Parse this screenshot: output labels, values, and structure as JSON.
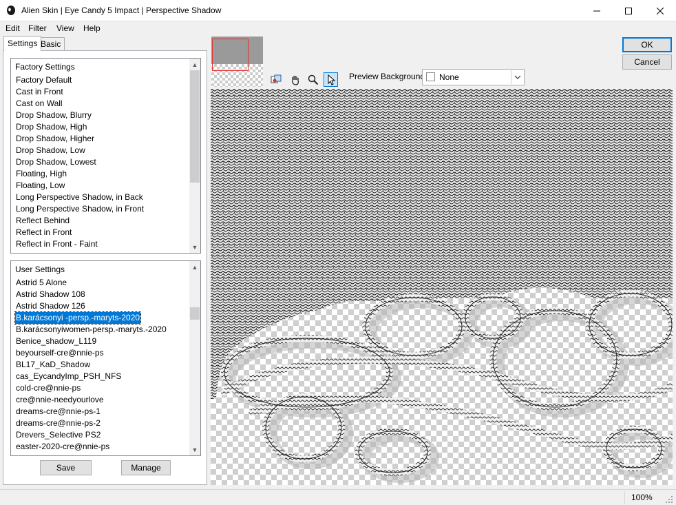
{
  "window": {
    "title": "Alien Skin | Eye Candy 5 Impact | Perspective Shadow"
  },
  "menu": {
    "edit": "Edit",
    "filter": "Filter",
    "view": "View",
    "help": "Help"
  },
  "tabs": {
    "settings": "Settings",
    "basic": "Basic"
  },
  "factory_settings": {
    "header": "Factory Settings",
    "items": [
      "Factory Default",
      "Cast in Front",
      "Cast on Wall",
      "Drop Shadow, Blurry",
      "Drop Shadow, High",
      "Drop Shadow, Higher",
      "Drop Shadow, Low",
      "Drop Shadow, Lowest",
      "Floating, High",
      "Floating, Low",
      "Long Perspective Shadow, in Back",
      "Long Perspective Shadow, in Front",
      "Reflect Behind",
      "Reflect in Front",
      "Reflect in Front - Faint"
    ]
  },
  "user_settings": {
    "header": "User Settings",
    "items": [
      "Astrid 5 Alone",
      "Astrid Shadow 108",
      "Astrid Shadow 126",
      "B.karácsonyi -persp.-maryts-2020",
      "B.karácsonyiwomen-persp.-maryts.-2020",
      "Benice_shadow_L119",
      "beyourself-cre@nnie-ps",
      "BL17_KaD_Shadow",
      "cas_EycandyImp_PSH_NFS",
      "cold-cre@nnie-ps",
      "cre@nnie-needyourlove",
      "dreams-cre@nnie-ps-1",
      "dreams-cre@nnie-ps-2",
      "Drevers_Selective PS2",
      "easter-2020-cre@nnie-ps"
    ],
    "selected_index": 3
  },
  "buttons": {
    "save": "Save",
    "manage": "Manage",
    "ok": "OK",
    "cancel": "Cancel"
  },
  "preview_background": {
    "label": "Preview Background:",
    "value": "None"
  },
  "tools": [
    "toggle-preview-icon",
    "hand-icon",
    "zoom-icon",
    "arrow-cursor-icon"
  ],
  "status": {
    "zoom": "100%"
  },
  "colors": {
    "selection": "#0078d7",
    "thumbnail_marker": "#e0302f"
  }
}
